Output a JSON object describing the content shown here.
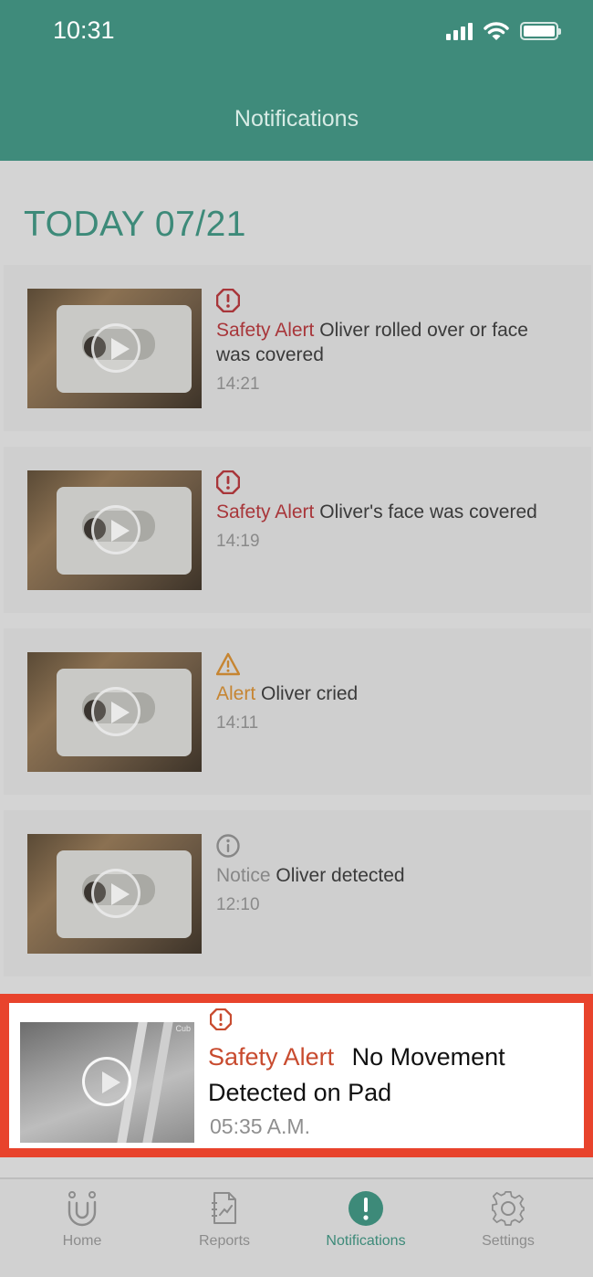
{
  "status_bar": {
    "time": "10:31"
  },
  "header": {
    "title": "Notifications"
  },
  "section": {
    "title": "TODAY 07/21"
  },
  "notifications": [
    {
      "type": "Safety Alert",
      "message": "Oliver rolled over or face was covered",
      "time": "14:21",
      "icon": "safety-alert-icon",
      "color": "#a8363a"
    },
    {
      "type": "Safety Alert",
      "message": "Oliver's face was covered",
      "time": "14:19",
      "icon": "safety-alert-icon",
      "color": "#a8363a"
    },
    {
      "type": "Alert",
      "message": "Oliver cried",
      "time": "14:11",
      "icon": "warning-icon",
      "color": "#c68532"
    },
    {
      "type": "Notice",
      "message": "Oliver detected",
      "time": "12:10",
      "icon": "info-icon",
      "color": "#878787"
    }
  ],
  "highlighted": {
    "type": "Safety Alert",
    "message": "No Movement Detected on Pad",
    "time": "05:35 A.M.",
    "thumb_stamp": "Cub",
    "icon": "safety-alert-icon",
    "color": "#c84b2f"
  },
  "tabs": [
    {
      "label": "Home",
      "icon": "home-icon"
    },
    {
      "label": "Reports",
      "icon": "reports-icon"
    },
    {
      "label": "Notifications",
      "icon": "notifications-icon",
      "active": true
    },
    {
      "label": "Settings",
      "icon": "settings-icon"
    }
  ],
  "colors": {
    "brand": "#3f8b7b",
    "highlight_border": "#e8432c"
  }
}
